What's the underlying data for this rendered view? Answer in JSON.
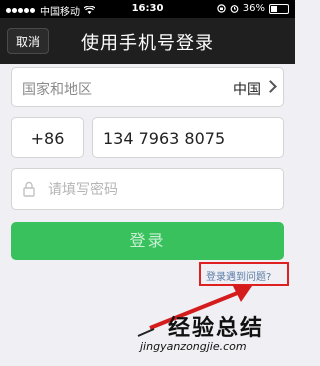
{
  "status_bar": {
    "carrier": "中国移动",
    "time": "16:30",
    "battery": "36%"
  },
  "nav": {
    "cancel_label": "取消",
    "title": "使用手机号登录"
  },
  "form": {
    "region_label": "国家和地区",
    "region_value": "中国",
    "country_code": "+86",
    "phone_number": "134 7963 8075",
    "password_placeholder": "请填写密码",
    "login_label": "登录",
    "problem_link": "登录遇到问题?"
  },
  "watermark": {
    "title": "经验总结",
    "url": "jingyanzongjie.com"
  },
  "colors": {
    "accent_green": "#39c15d",
    "link_blue": "#5a7da7",
    "highlight_red": "#e02020",
    "nav_background": "#1f1f1f"
  },
  "icons": [
    "signal-dots-icon",
    "wifi-icon",
    "lock-orientation-icon",
    "alarm-icon",
    "battery-icon",
    "chevron-right-icon",
    "lock-icon",
    "arrow-icon"
  ]
}
